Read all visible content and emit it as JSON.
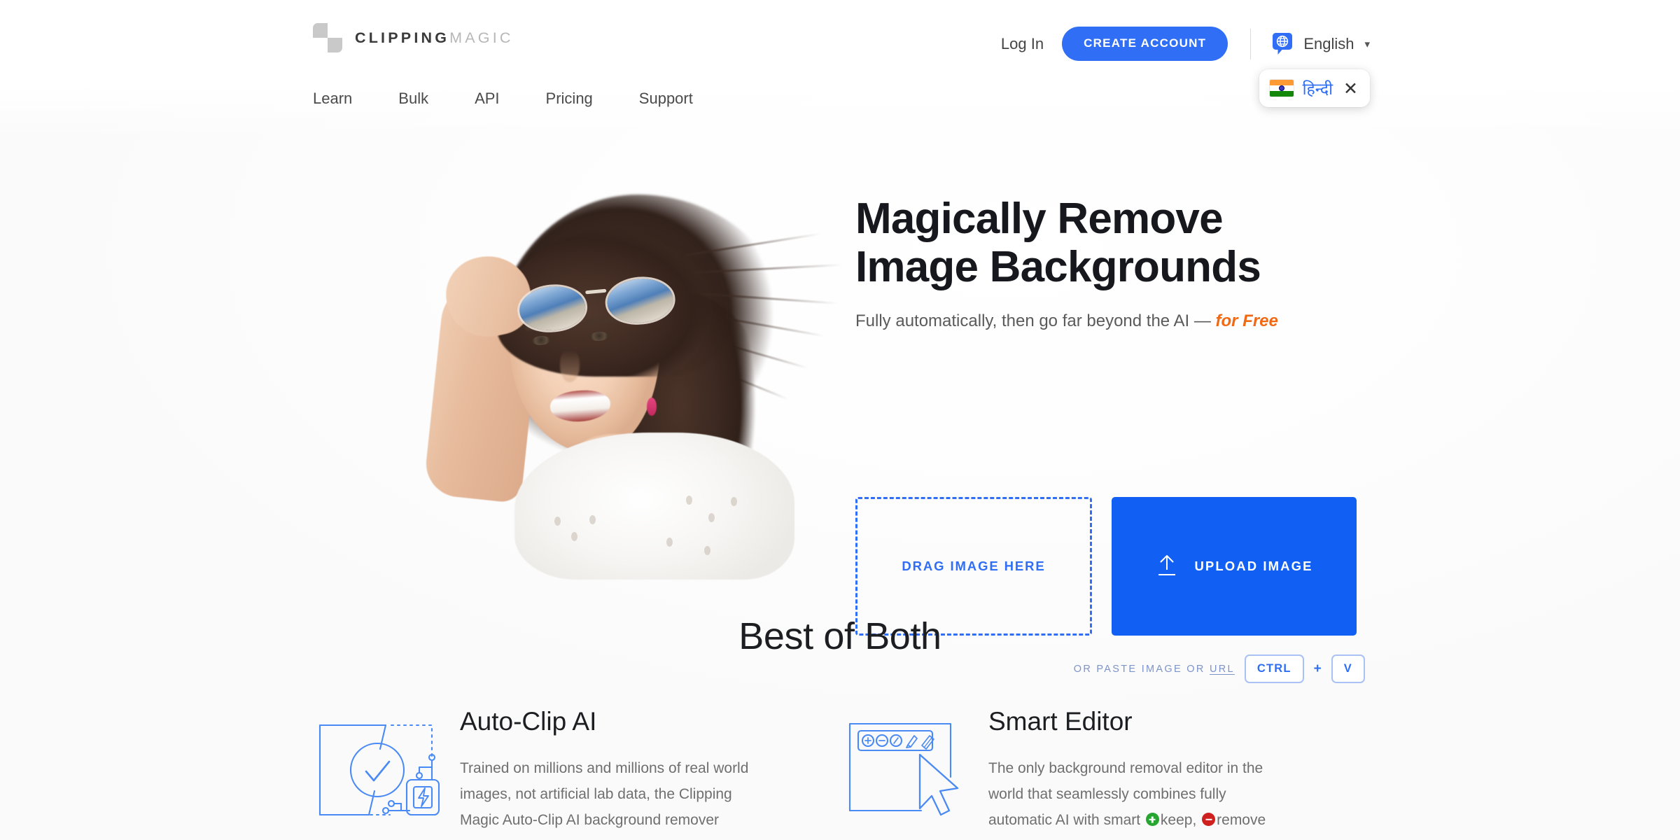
{
  "brand": {
    "name_bold": "CLIPPING",
    "name_light": "MAGIC",
    "logo_icon": "checkerboard-logo"
  },
  "header": {
    "login_label": "Log In",
    "create_account_label": "CREATE ACCOUNT",
    "language_label": "English",
    "globe_icon": "globe-speech-bubble-icon",
    "caret_icon": "chevron-down-icon",
    "nav": [
      {
        "label": "Learn"
      },
      {
        "label": "Bulk"
      },
      {
        "label": "API"
      },
      {
        "label": "Pricing"
      },
      {
        "label": "Support"
      }
    ],
    "language_suggestion": {
      "flag": "india-flag-icon",
      "label": "हिन्दी",
      "close_icon": "close-icon"
    }
  },
  "hero": {
    "headline_line1": "Magically Remove",
    "headline_line2": "Image Backgrounds",
    "subhead_main": "Fully automatically, then go far beyond the AI — ",
    "subhead_accent": "for Free",
    "dropzone_label": "DRAG IMAGE HERE",
    "upload_label": "UPLOAD IMAGE",
    "upload_icon": "upload-arrow-icon",
    "paste_prefix": "OR PASTE IMAGE OR ",
    "paste_url": "URL",
    "key_ctrl": "CTRL",
    "key_plus": "+",
    "key_v": "V",
    "photo_alt": "woman-with-sunglasses-photo"
  },
  "best_of_both": {
    "title": "Best of Both",
    "features": [
      {
        "icon": "auto-clip-ai-chip-icon",
        "title": "Auto-Clip AI",
        "text_part1": "Trained on millions and millions of real world images, not artificial lab data, the Clipping Magic Auto-Clip AI background remover"
      },
      {
        "icon": "smart-editor-window-cursor-icon",
        "title": "Smart Editor",
        "text_part1": "The only background removal editor in the world that seamlessly combines fully automatic AI with smart ",
        "text_keep": "keep",
        "text_mid": ", ",
        "text_remove": "remove"
      }
    ]
  },
  "colors": {
    "primary_blue": "#2f6ef5",
    "upload_blue": "#1160f3",
    "accent_orange": "#f06a15",
    "keep_green": "#27a531",
    "remove_red": "#cf2020",
    "icon_blue": "#4a8af4"
  }
}
